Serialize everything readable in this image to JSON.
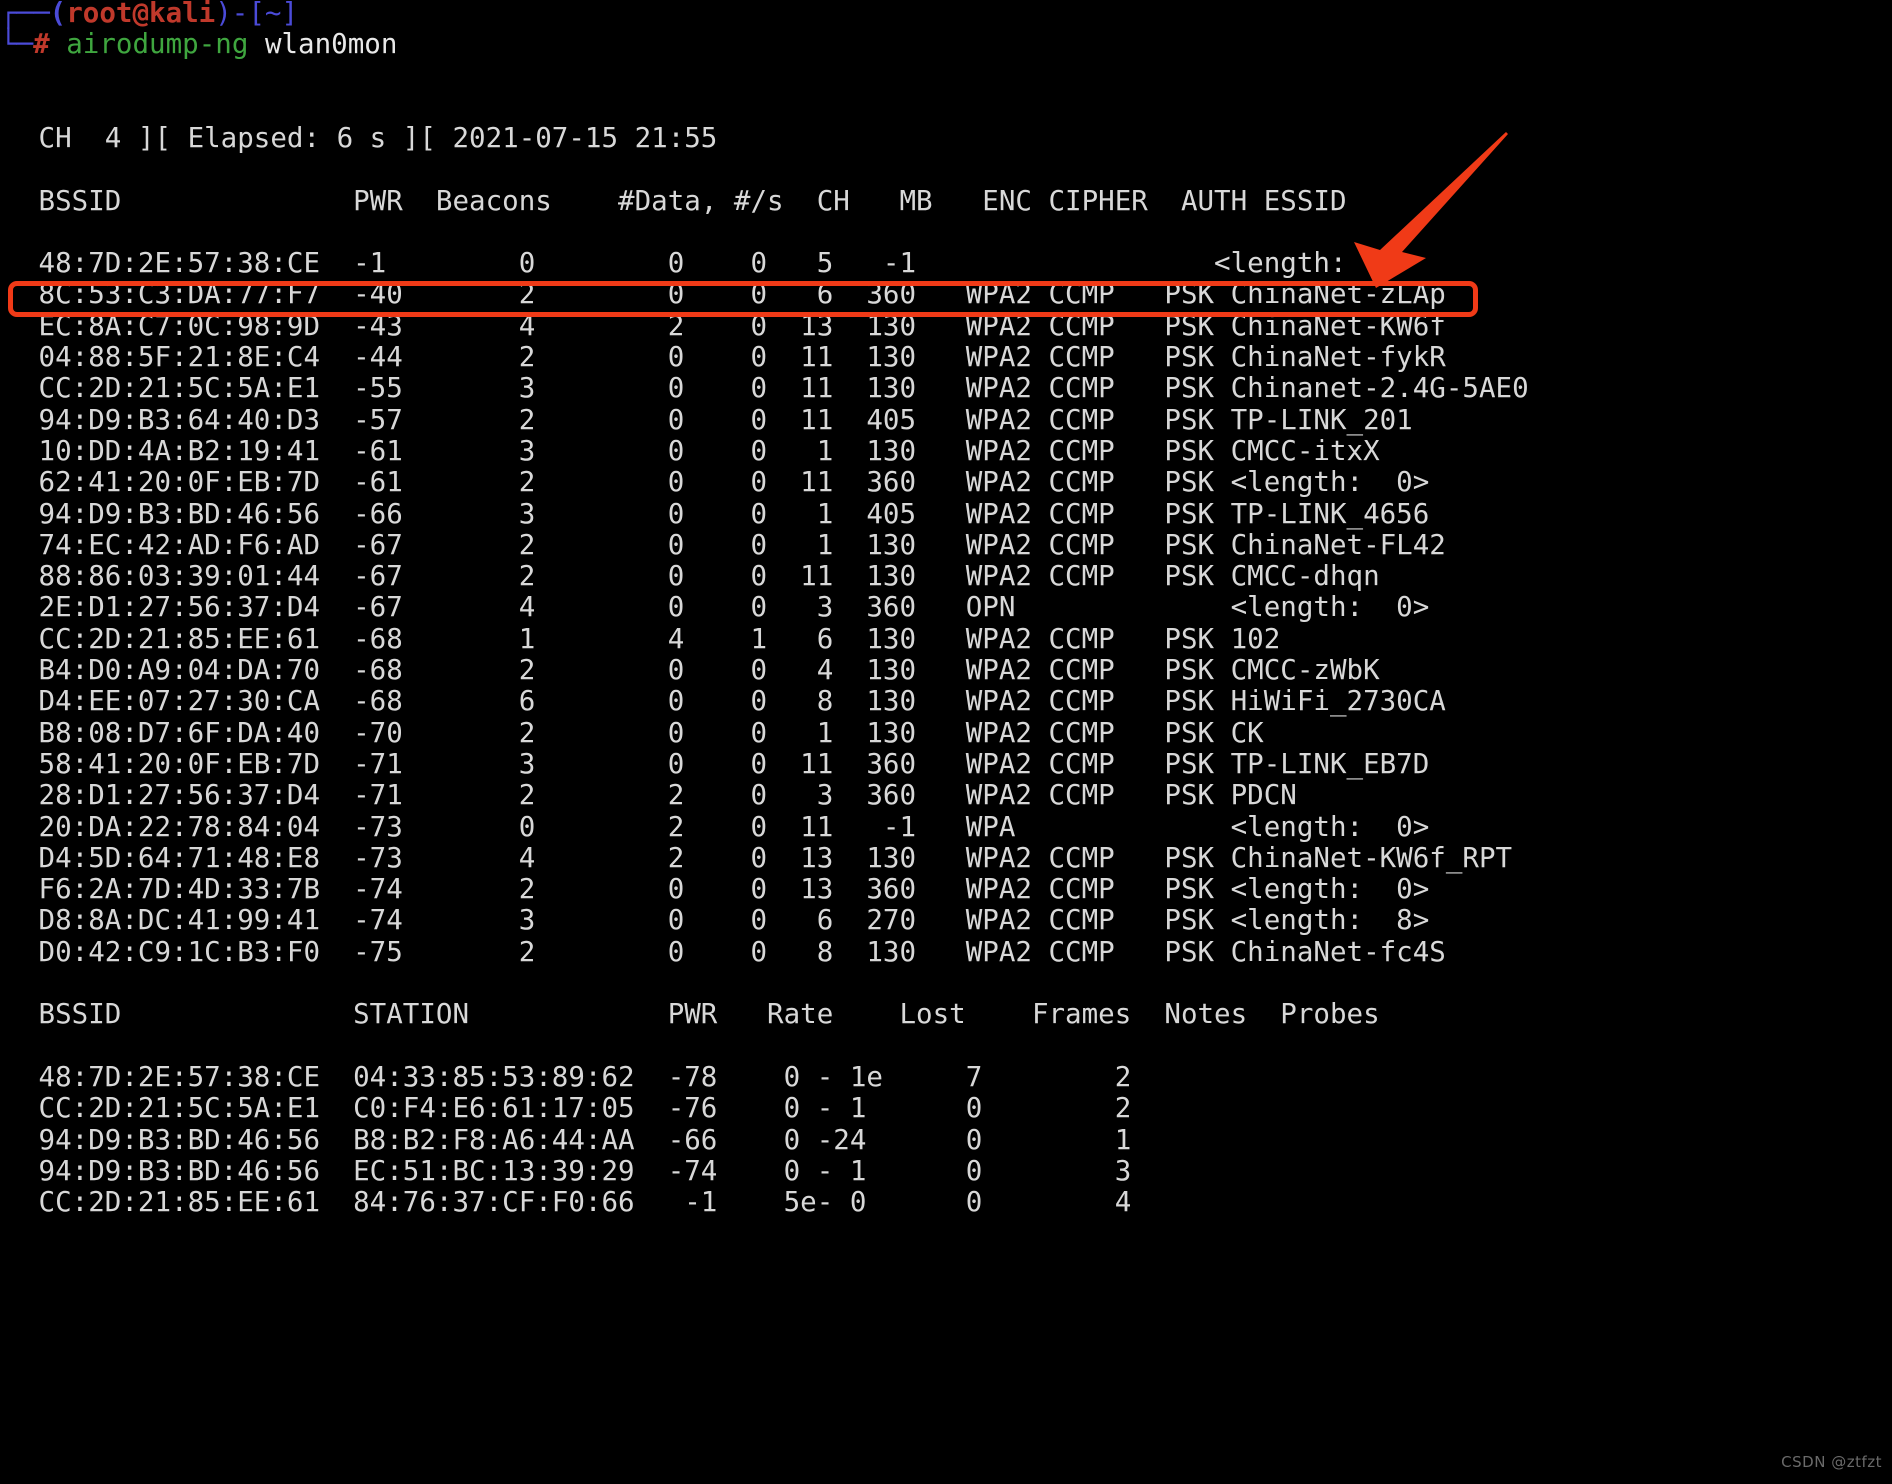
{
  "terminal": {
    "prompt": {
      "line1_prefix": "┌──(",
      "user_host": "root@kali",
      "line1_mid": ")-[",
      "cwd": "~",
      "line1_suffix": "]",
      "line2_prefix": "└─",
      "hash": "#",
      "command": "airodump-ng",
      "argument": "wlan0mon"
    },
    "status_line": " CH  4 ][ Elapsed: 6 s ][ 2021-07-15 21:55",
    "ap_header": " BSSID              PWR  Beacons    #Data, #/s  CH   MB   ENC CIPHER  AUTH ESSID",
    "station_header": " BSSID              STATION            PWR   Rate    Lost    Frames  Notes  Probes",
    "ap_columns": [
      "BSSID",
      "PWR",
      "Beacons",
      "#Data,",
      "#/s",
      "CH",
      "MB",
      "ENC",
      "CIPHER",
      "AUTH",
      "ESSID"
    ],
    "station_columns": [
      "BSSID",
      "STATION",
      "PWR",
      "Rate",
      "Lost",
      "Frames",
      "Notes",
      "Probes"
    ],
    "ap_rows": [
      " 48:7D:2E:57:38:CE  -1        0        0    0   5   -1                  <length:  0>",
      " 8C:53:C3:DA:77:F7  -40       2        0    0   6  360   WPA2 CCMP   PSK ChinaNet-zLAp",
      " EC:8A:C7:0C:98:9D  -43       4        2    0  13  130   WPA2 CCMP   PSK ChinaNet-KW6f",
      " 04:88:5F:21:8E:C4  -44       2        0    0  11  130   WPA2 CCMP   PSK ChinaNet-fykR",
      " CC:2D:21:5C:5A:E1  -55       3        0    0  11  130   WPA2 CCMP   PSK Chinanet-2.4G-5AE0",
      " 94:D9:B3:64:40:D3  -57       2        0    0  11  405   WPA2 CCMP   PSK TP-LINK_201",
      " 10:DD:4A:B2:19:41  -61       3        0    0   1  130   WPA2 CCMP   PSK CMCC-itxX",
      " 62:41:20:0F:EB:7D  -61       2        0    0  11  360   WPA2 CCMP   PSK <length:  0>",
      " 94:D9:B3:BD:46:56  -66       3        0    0   1  405   WPA2 CCMP   PSK TP-LINK_4656",
      " 74:EC:42:AD:F6:AD  -67       2        0    0   1  130   WPA2 CCMP   PSK ChinaNet-FL42",
      " 88:86:03:39:01:44  -67       2        0    0  11  130   WPA2 CCMP   PSK CMCC-dhqn",
      " 2E:D1:27:56:37:D4  -67       4        0    0   3  360   OPN             <length:  0>",
      " CC:2D:21:85:EE:61  -68       1        4    1   6  130   WPA2 CCMP   PSK 102",
      " B4:D0:A9:04:DA:70  -68       2        0    0   4  130   WPA2 CCMP   PSK CMCC-zWbK",
      " D4:EE:07:27:30:CA  -68       6        0    0   8  130   WPA2 CCMP   PSK HiWiFi_2730CA",
      " B8:08:D7:6F:DA:40  -70       2        0    0   1  130   WPA2 CCMP   PSK CK",
      " 58:41:20:0F:EB:7D  -71       3        0    0  11  360   WPA2 CCMP   PSK TP-LINK_EB7D",
      " 28:D1:27:56:37:D4  -71       2        2    0   3  360   WPA2 CCMP   PSK PDCN",
      " 20:DA:22:78:84:04  -73       0        2    0  11   -1   WPA             <length:  0>",
      " D4:5D:64:71:48:E8  -73       4        2    0  13  130   WPA2 CCMP   PSK ChinaNet-KW6f_RPT",
      " F6:2A:7D:4D:33:7B  -74       2        0    0  13  360   WPA2 CCMP   PSK <length:  0>",
      " D8:8A:DC:41:99:41  -74       3        0    0   6  270   WPA2 CCMP   PSK <length:  8>",
      " D0:42:C9:1C:B3:F0  -75       2        0    0   8  130   WPA2 CCMP   PSK ChinaNet-fc4S"
    ],
    "ap_rows_parsed": [
      {
        "bssid": "48:7D:2E:57:38:CE",
        "pwr": "-1",
        "beacons": "0",
        "data": "0",
        "ps": "0",
        "ch": "5",
        "mb": "-1",
        "enc": "",
        "cipher": "",
        "auth": "",
        "essid": "<length:  0>"
      },
      {
        "bssid": "8C:53:C3:DA:77:F7",
        "pwr": "-40",
        "beacons": "2",
        "data": "0",
        "ps": "0",
        "ch": "6",
        "mb": "360",
        "enc": "WPA2",
        "cipher": "CCMP",
        "auth": "PSK",
        "essid": "ChinaNet-zLAp"
      },
      {
        "bssid": "EC:8A:C7:0C:98:9D",
        "pwr": "-43",
        "beacons": "4",
        "data": "2",
        "ps": "0",
        "ch": "13",
        "mb": "130",
        "enc": "WPA2",
        "cipher": "CCMP",
        "auth": "PSK",
        "essid": "ChinaNet-KW6f"
      },
      {
        "bssid": "04:88:5F:21:8E:C4",
        "pwr": "-44",
        "beacons": "2",
        "data": "0",
        "ps": "0",
        "ch": "11",
        "mb": "130",
        "enc": "WPA2",
        "cipher": "CCMP",
        "auth": "PSK",
        "essid": "ChinaNet-fykR"
      },
      {
        "bssid": "CC:2D:21:5C:5A:E1",
        "pwr": "-55",
        "beacons": "3",
        "data": "0",
        "ps": "0",
        "ch": "11",
        "mb": "130",
        "enc": "WPA2",
        "cipher": "CCMP",
        "auth": "PSK",
        "essid": "Chinanet-2.4G-5AE0"
      },
      {
        "bssid": "94:D9:B3:64:40:D3",
        "pwr": "-57",
        "beacons": "2",
        "data": "0",
        "ps": "0",
        "ch": "11",
        "mb": "405",
        "enc": "WPA2",
        "cipher": "CCMP",
        "auth": "PSK",
        "essid": "TP-LINK_201"
      },
      {
        "bssid": "10:DD:4A:B2:19:41",
        "pwr": "-61",
        "beacons": "3",
        "data": "0",
        "ps": "0",
        "ch": "1",
        "mb": "130",
        "enc": "WPA2",
        "cipher": "CCMP",
        "auth": "PSK",
        "essid": "CMCC-itxX"
      },
      {
        "bssid": "62:41:20:0F:EB:7D",
        "pwr": "-61",
        "beacons": "2",
        "data": "0",
        "ps": "0",
        "ch": "11",
        "mb": "360",
        "enc": "WPA2",
        "cipher": "CCMP",
        "auth": "PSK",
        "essid": "<length:  0>"
      },
      {
        "bssid": "94:D9:B3:BD:46:56",
        "pwr": "-66",
        "beacons": "3",
        "data": "0",
        "ps": "0",
        "ch": "1",
        "mb": "405",
        "enc": "WPA2",
        "cipher": "CCMP",
        "auth": "PSK",
        "essid": "TP-LINK_4656"
      },
      {
        "bssid": "74:EC:42:AD:F6:AD",
        "pwr": "-67",
        "beacons": "2",
        "data": "0",
        "ps": "0",
        "ch": "1",
        "mb": "130",
        "enc": "WPA2",
        "cipher": "CCMP",
        "auth": "PSK",
        "essid": "ChinaNet-FL42"
      },
      {
        "bssid": "88:86:03:39:01:44",
        "pwr": "-67",
        "beacons": "2",
        "data": "0",
        "ps": "0",
        "ch": "11",
        "mb": "130",
        "enc": "WPA2",
        "cipher": "CCMP",
        "auth": "PSK",
        "essid": "CMCC-dhqn"
      },
      {
        "bssid": "2E:D1:27:56:37:D4",
        "pwr": "-67",
        "beacons": "4",
        "data": "0",
        "ps": "0",
        "ch": "3",
        "mb": "360",
        "enc": "OPN",
        "cipher": "",
        "auth": "",
        "essid": "<length:  0>"
      },
      {
        "bssid": "CC:2D:21:85:EE:61",
        "pwr": "-68",
        "beacons": "1",
        "data": "4",
        "ps": "1",
        "ch": "6",
        "mb": "130",
        "enc": "WPA2",
        "cipher": "CCMP",
        "auth": "PSK",
        "essid": "102"
      },
      {
        "bssid": "B4:D0:A9:04:DA:70",
        "pwr": "-68",
        "beacons": "2",
        "data": "0",
        "ps": "0",
        "ch": "4",
        "mb": "130",
        "enc": "WPA2",
        "cipher": "CCMP",
        "auth": "PSK",
        "essid": "CMCC-zWbK"
      },
      {
        "bssid": "D4:EE:07:27:30:CA",
        "pwr": "-68",
        "beacons": "6",
        "data": "0",
        "ps": "0",
        "ch": "8",
        "mb": "130",
        "enc": "WPA2",
        "cipher": "CCMP",
        "auth": "PSK",
        "essid": "HiWiFi_2730CA"
      },
      {
        "bssid": "B8:08:D7:6F:DA:40",
        "pwr": "-70",
        "beacons": "2",
        "data": "0",
        "ps": "0",
        "ch": "1",
        "mb": "130",
        "enc": "WPA2",
        "cipher": "CCMP",
        "auth": "PSK",
        "essid": "CK"
      },
      {
        "bssid": "58:41:20:0F:EB:7D",
        "pwr": "-71",
        "beacons": "3",
        "data": "0",
        "ps": "0",
        "ch": "11",
        "mb": "360",
        "enc": "WPA2",
        "cipher": "CCMP",
        "auth": "PSK",
        "essid": "TP-LINK_EB7D"
      },
      {
        "bssid": "28:D1:27:56:37:D4",
        "pwr": "-71",
        "beacons": "2",
        "data": "2",
        "ps": "0",
        "ch": "3",
        "mb": "360",
        "enc": "WPA2",
        "cipher": "CCMP",
        "auth": "PSK",
        "essid": "PDCN"
      },
      {
        "bssid": "20:DA:22:78:84:04",
        "pwr": "-73",
        "beacons": "0",
        "data": "2",
        "ps": "0",
        "ch": "11",
        "mb": "-1",
        "enc": "WPA",
        "cipher": "",
        "auth": "",
        "essid": "<length:  0>"
      },
      {
        "bssid": "D4:5D:64:71:48:E8",
        "pwr": "-73",
        "beacons": "4",
        "data": "2",
        "ps": "0",
        "ch": "13",
        "mb": "130",
        "enc": "WPA2",
        "cipher": "CCMP",
        "auth": "PSK",
        "essid": "ChinaNet-KW6f_RPT"
      },
      {
        "bssid": "F6:2A:7D:4D:33:7B",
        "pwr": "-74",
        "beacons": "2",
        "data": "0",
        "ps": "0",
        "ch": "13",
        "mb": "360",
        "enc": "WPA2",
        "cipher": "CCMP",
        "auth": "PSK",
        "essid": "<length:  0>"
      },
      {
        "bssid": "D8:8A:DC:41:99:41",
        "pwr": "-74",
        "beacons": "3",
        "data": "0",
        "ps": "0",
        "ch": "6",
        "mb": "270",
        "enc": "WPA2",
        "cipher": "CCMP",
        "auth": "PSK",
        "essid": "<length:  8>"
      },
      {
        "bssid": "D0:42:C9:1C:B3:F0",
        "pwr": "-75",
        "beacons": "2",
        "data": "0",
        "ps": "0",
        "ch": "8",
        "mb": "130",
        "enc": "WPA2",
        "cipher": "CCMP",
        "auth": "PSK",
        "essid": "ChinaNet-fc4S"
      }
    ],
    "station_rows": [
      " 48:7D:2E:57:38:CE  04:33:85:53:89:62  -78    0 - 1e     7        2",
      " CC:2D:21:5C:5A:E1  C0:F4:E6:61:17:05  -76    0 - 1      0        2",
      " 94:D9:B3:BD:46:56  B8:B2:F8:A6:44:AA  -66    0 -24      0        1",
      " 94:D9:B3:BD:46:56  EC:51:BC:13:39:29  -74    0 - 1      0        3",
      " CC:2D:21:85:EE:61  84:76:37:CF:F0:66   -1    5e- 0      0        4"
    ],
    "station_rows_parsed": [
      {
        "bssid": "48:7D:2E:57:38:CE",
        "station": "04:33:85:53:89:62",
        "pwr": "-78",
        "rate": "0 - 1e",
        "lost": "7",
        "frames": "2",
        "notes": "",
        "probes": ""
      },
      {
        "bssid": "CC:2D:21:5C:5A:E1",
        "station": "C0:F4:E6:61:17:05",
        "pwr": "-76",
        "rate": "0 - 1",
        "lost": "0",
        "frames": "2",
        "notes": "",
        "probes": ""
      },
      {
        "bssid": "94:D9:B3:BD:46:56",
        "station": "B8:B2:F8:A6:44:AA",
        "pwr": "-66",
        "rate": "0 -24",
        "lost": "0",
        "frames": "1",
        "notes": "",
        "probes": ""
      },
      {
        "bssid": "94:D9:B3:BD:46:56",
        "station": "EC:51:BC:13:39:29",
        "pwr": "-74",
        "rate": "0 - 1",
        "lost": "0",
        "frames": "3",
        "notes": "",
        "probes": ""
      },
      {
        "bssid": "CC:2D:21:85:EE:61",
        "station": "84:76:37:CF:F0:66",
        "pwr": "-1",
        "rate": "5e- 0",
        "lost": "0",
        "frames": "4",
        "notes": "",
        "probes": ""
      }
    ]
  },
  "annotations": {
    "highlight_color": "#f03a17",
    "highlighted_row_bssid": "8C:53:C3:DA:77:F7",
    "arrow_target": "ESSID ChinaNet-zLAp"
  },
  "watermark": "CSDN @ztfzt",
  "colors": {
    "background": "#000000",
    "foreground": "#d8d8d8",
    "prompt_blue": "#4b4bd8",
    "prompt_red": "#c0392b",
    "command_green": "#3fa63f",
    "accent_red": "#f03a17"
  }
}
